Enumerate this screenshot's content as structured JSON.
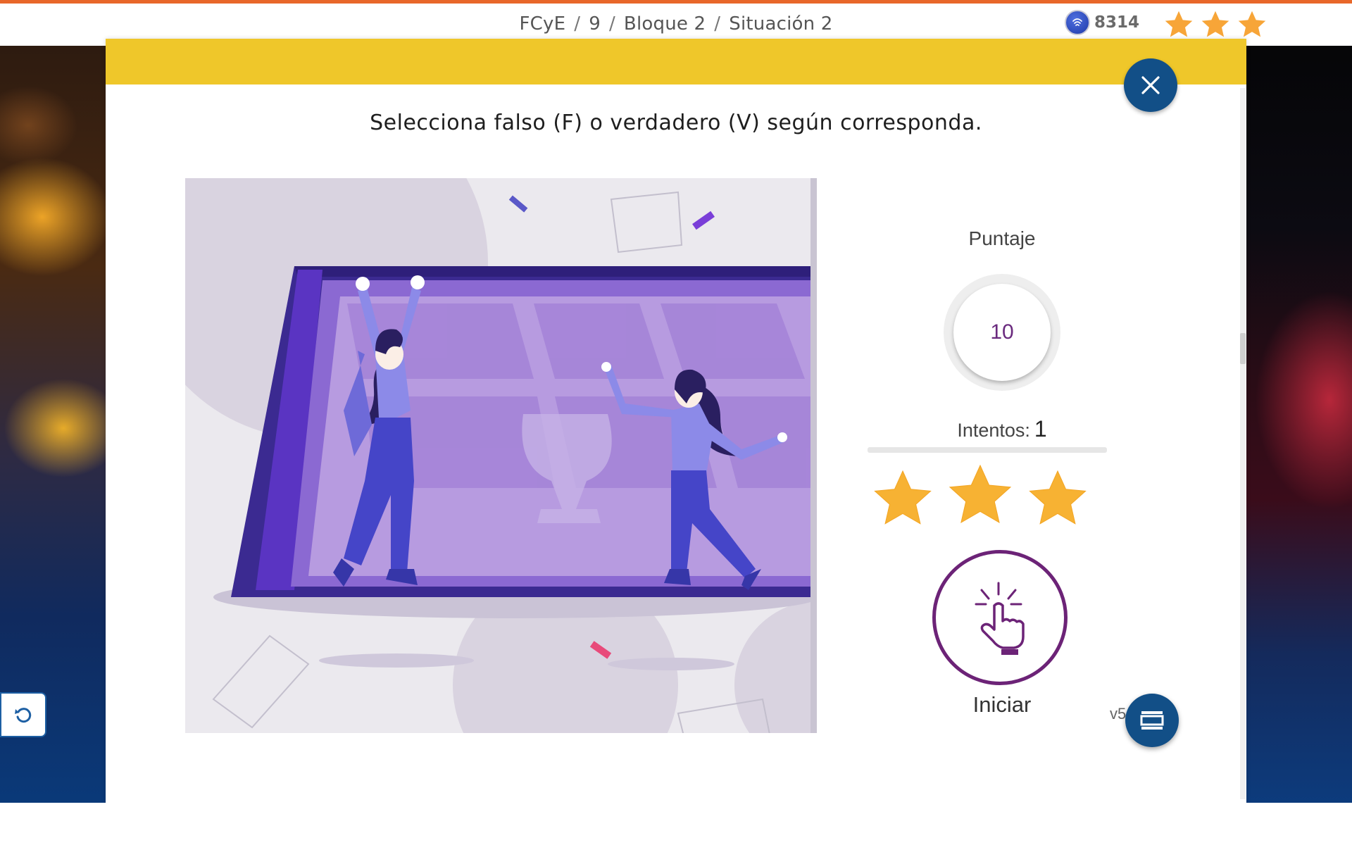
{
  "header": {
    "breadcrumb": [
      "FCyE",
      "9",
      "Bloque 2",
      "Situación 2"
    ],
    "coins": "8314",
    "stars_filled": 3
  },
  "activity": {
    "instruction": "Selecciona falso (F) o verdadero (V) según corresponda.",
    "score_label": "Puntaje",
    "score_value": "10",
    "attempts_label": "Intentos:",
    "attempts_value": "1",
    "result_stars": 3,
    "start_label": "Iniciar",
    "version": "v5"
  },
  "icons": {
    "close": "close-icon",
    "coin": "coin-icon",
    "star": "star-icon",
    "tap": "tap-hand-icon",
    "layout": "layout-icon",
    "refresh": "refresh-icon"
  },
  "colors": {
    "accent_orange": "#e8672a",
    "banner_yellow": "#efc72a",
    "primary_blue": "#124f87",
    "star": "#f7b233",
    "purple": "#6c2377"
  }
}
